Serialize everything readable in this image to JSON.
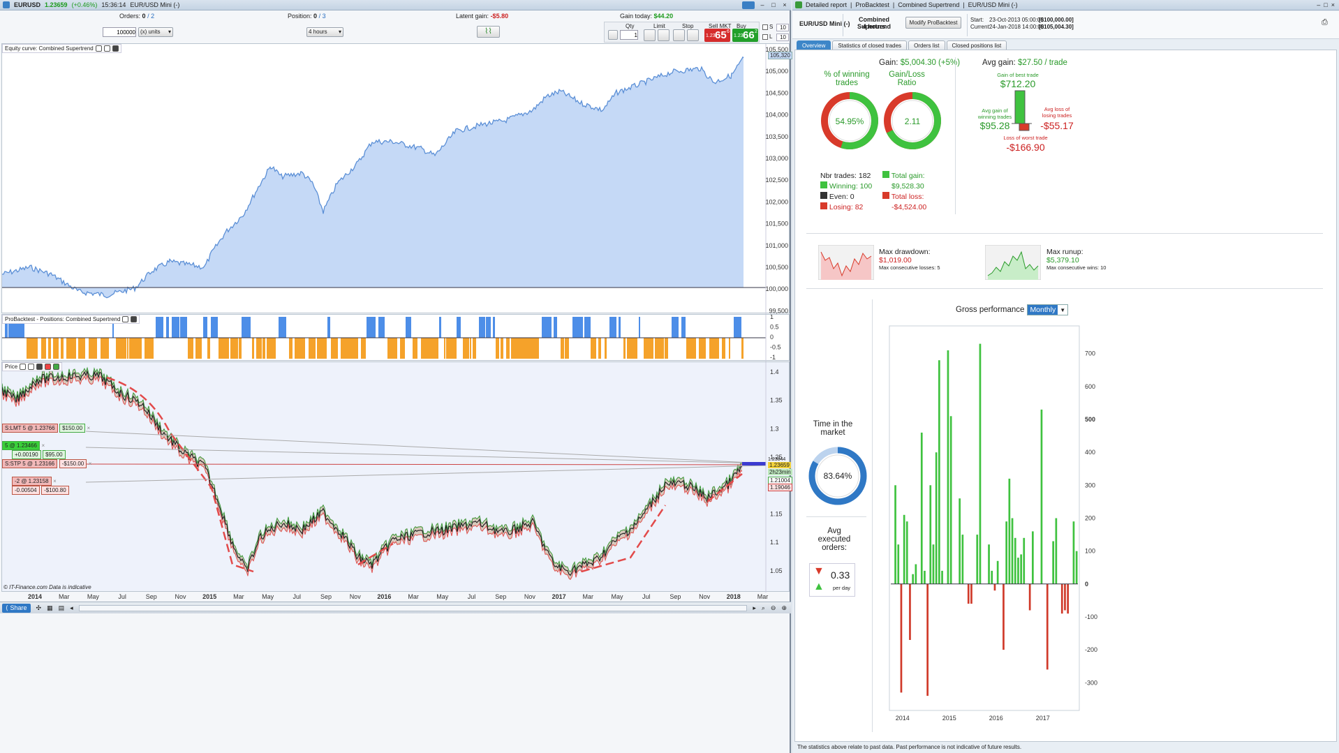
{
  "top": {
    "symbol": "EURUSD",
    "price": "1.23659",
    "change": "(+0.46%)",
    "time": "15:36:14",
    "instrument": "EUR/USD Mini (-)",
    "orders_label": "Orders:",
    "orders_value": "0",
    "orders_total": "/ 2",
    "position_label": "Position:",
    "position_value": "0",
    "position_total": "/ 3",
    "latent_label": "Latent gain:",
    "latent_value": "-$5.80",
    "gaintoday_label": "Gain today:",
    "gaintoday_value": "$44.20",
    "qty_input": "100000",
    "units_select": "(x) units",
    "timeframe_select": "4 hours",
    "qty_label": "Qty",
    "qty_value": "1",
    "limit_label": "Limit",
    "stop_label": "Stop",
    "sell_label": "Sell MKT",
    "buy_label": "Buy MKT",
    "sell_small": "1.23",
    "sell_big": "65",
    "sell_sup": "6",
    "buy_small": "1.23",
    "buy_big": "66",
    "buy_sup": "2",
    "s_label": "S",
    "l_label": "L",
    "s_value": "10",
    "l_value": "10"
  },
  "panels": {
    "equity_title": "Equity curve: Combined Supertrend",
    "positions_title": "ProBacktest - Positions: Combined Supertrend",
    "price_title": "Price",
    "footer_credit": "© IT-Finance.com  Data is indicative",
    "equity_last": "105,320",
    "equity_ticks": [
      "105,500",
      "105,000",
      "104,500",
      "104,000",
      "103,500",
      "103,000",
      "102,500",
      "102,000",
      "101,500",
      "101,000",
      "100,500",
      "100,000",
      "99,500"
    ],
    "pos_ticks": [
      "1",
      "0.5",
      "0",
      "-0.5",
      "-1"
    ],
    "price_ticks": [
      "1.4",
      "1.35",
      "1.3",
      "1.25",
      "1.2",
      "1.15",
      "1.1",
      "1.05"
    ],
    "price_marks": [
      "1.23844",
      "1.23659",
      "2h23min",
      "1.21004",
      "1.19046"
    ],
    "x_labels": [
      "2014",
      "Mar",
      "May",
      "Jul",
      "Sep",
      "Nov",
      "2015",
      "Mar",
      "May",
      "Jul",
      "Sep",
      "Nov",
      "2016",
      "Mar",
      "May",
      "Jul",
      "Sep",
      "Nov",
      "2017",
      "Mar",
      "May",
      "Jul",
      "Sep",
      "Nov",
      "2018",
      "Mar"
    ],
    "orders": [
      {
        "label": "S:LMT 5 @ 1.23766",
        "pnl": "$150.00",
        "kind": "red"
      },
      {
        "label": "5 @ 1.23466",
        "pnl": "+0.00190",
        "pnl2": "$95.00",
        "kind": "green"
      },
      {
        "label": "S:STP 5 @ 1.23166",
        "pnl": "-$150.00",
        "kind": "red"
      },
      {
        "label": "-2 @ 1.23158",
        "pnl": "-0.00504",
        "pnl2": "-$100.80",
        "kind": "red"
      }
    ]
  },
  "bottombar": {
    "share": "Share"
  },
  "report": {
    "window_title_parts": [
      "Detailed report",
      "ProBacktest",
      "Combined Supertrend",
      "EUR/USD Mini (-)"
    ],
    "instrument": "EUR/USD Mini (-)",
    "system": "Combined Supertrend",
    "system_tf": "4 hours",
    "modify_button": "Modify ProBacktest",
    "start_label": "Start:",
    "start_value": "23-Oct-2013 05:00:00",
    "start_capital": "[$100,000.00]",
    "current_label": "Current:",
    "current_value": "24-Jan-2018 14:00:00",
    "current_capital": "[$105,004.30]",
    "tabs": [
      "Overview",
      "Statistics of closed trades",
      "Orders list",
      "Closed positions list"
    ],
    "gain_label": "Gain:",
    "gain_value": "$5,004.30 (+5%)",
    "winning_pct_title": "% of winning trades",
    "winning_pct": "54.95%",
    "gainloss_title": "Gain/Loss Ratio",
    "gainloss_value": "2.11",
    "nbr_trades": "Nbr trades: 182",
    "winning": "Winning: 100",
    "even": "Even: 0",
    "losing": "Losing: 82",
    "total_gain_label": "Total gain:",
    "total_gain": "$9,528.30",
    "total_loss_label": "Total loss:",
    "total_loss": "-$4,524.00",
    "avg_gain_label": "Avg gain:",
    "avg_gain_value": "$27.50 / trade",
    "best_trade_label": "Gain of best trade",
    "best_trade": "$712.20",
    "avg_win_label": "Avg gain of winning trades",
    "avg_win": "$95.28",
    "avg_loss_label": "Avg loss of losing trades",
    "avg_loss": "-$55.17",
    "worst_trade_label": "Loss of worst trade",
    "worst_trade": "-$166.90",
    "max_dd_label": "Max drawdown:",
    "max_dd": "$1,019.00",
    "max_consec_losses": "Max consecutive losses: 5",
    "max_runup_label": "Max runup:",
    "max_runup": "$5,379.10",
    "max_consec_wins": "Max consecutive wins: 10",
    "time_market_label": "Time in the market",
    "time_market": "83.64%",
    "avg_orders_label": "Avg executed orders:",
    "avg_orders": "0.33",
    "per_day": "per day",
    "gross_label": "Gross performance",
    "gross_period": "Monthly",
    "footer": "The statistics above relate to past data. Past performance is not indicative of future results."
  },
  "chart_data": {
    "type": "bar",
    "x_labels": [
      "2014",
      "2015",
      "2016",
      "2017"
    ],
    "ylim": [
      -380,
      780
    ],
    "yticks": [
      700,
      600,
      500,
      400,
      300,
      200,
      100,
      0,
      -100,
      -200,
      -300
    ],
    "values": [
      0,
      300,
      120,
      -330,
      210,
      190,
      -170,
      30,
      60,
      0,
      460,
      40,
      -340,
      300,
      120,
      400,
      680,
      40,
      0,
      710,
      510,
      0,
      0,
      260,
      150,
      0,
      -60,
      -60,
      0,
      150,
      730,
      0,
      0,
      120,
      40,
      -20,
      70,
      0,
      -200,
      190,
      320,
      200,
      140,
      80,
      90,
      140,
      0,
      -80,
      160,
      0,
      0,
      530,
      0,
      -260,
      0,
      130,
      200,
      0,
      -90,
      -80,
      -90,
      0,
      190,
      100
    ]
  }
}
